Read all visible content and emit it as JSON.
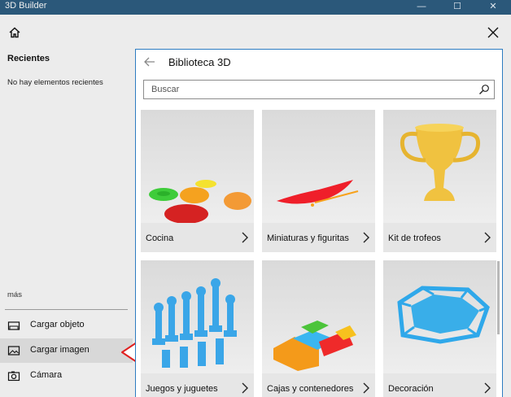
{
  "window": {
    "title": "3D Builder",
    "minimize": "—",
    "maximize": "☐",
    "close": "✕"
  },
  "left": {
    "title": "Recientes",
    "empty": "No hay elementos recientes",
    "more": "más",
    "items": [
      {
        "label": "Cargar objeto",
        "icon": "load-object-icon"
      },
      {
        "label": "Cargar imagen",
        "icon": "image-icon"
      },
      {
        "label": "Cámara",
        "icon": "camera-icon"
      }
    ]
  },
  "library": {
    "title": "Biblioteca 3D",
    "search_placeholder": "Buscar",
    "tiles": [
      {
        "label": "Cocina"
      },
      {
        "label": "Miniaturas y figuritas"
      },
      {
        "label": "Kit de trofeos"
      },
      {
        "label": "Juegos y juguetes"
      },
      {
        "label": "Cajas y contenedores"
      },
      {
        "label": "Decoración"
      }
    ]
  },
  "colors": {
    "accent": "#2d7cc1",
    "arrow": "#e02020",
    "titlebar": "#2b587a",
    "model_blue": "#3aa6e8"
  }
}
